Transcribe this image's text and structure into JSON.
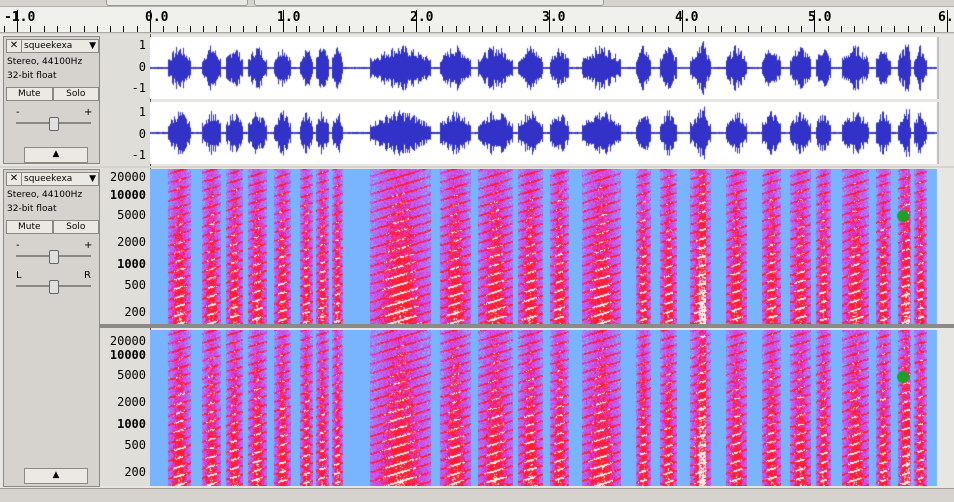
{
  "ruler": {
    "labels": [
      "-1.0",
      "0.0",
      "1.0",
      "2.0",
      "3.0",
      "4.0",
      "5.0",
      "6."
    ]
  },
  "tracks": [
    {
      "name": "squeekexa",
      "format": "Stereo, 44100Hz",
      "bits": "32-bit float",
      "mute_label": "Mute",
      "solo_label": "Solo",
      "gain_minus": "-",
      "gain_plus": "+",
      "view": "waveform",
      "channel_scale": [
        "1",
        "0",
        "-1"
      ]
    },
    {
      "name": "squeekexa",
      "format": "Stereo, 44100Hz",
      "bits": "32-bit float",
      "mute_label": "Mute",
      "solo_label": "Solo",
      "gain_minus": "-",
      "gain_plus": "+",
      "pan_left": "L",
      "pan_right": "R",
      "view": "spectrogram",
      "freq_labels": [
        "20000",
        "10000",
        "5000",
        "2000",
        "1000",
        "500",
        "200"
      ]
    }
  ],
  "colors": {
    "waveform": "#3232c8",
    "spec_low": "#78b4ff",
    "spec_mid": "#dc3cdc",
    "spec_high": "#ff1e32",
    "spec_peak": "#ffffff"
  }
}
